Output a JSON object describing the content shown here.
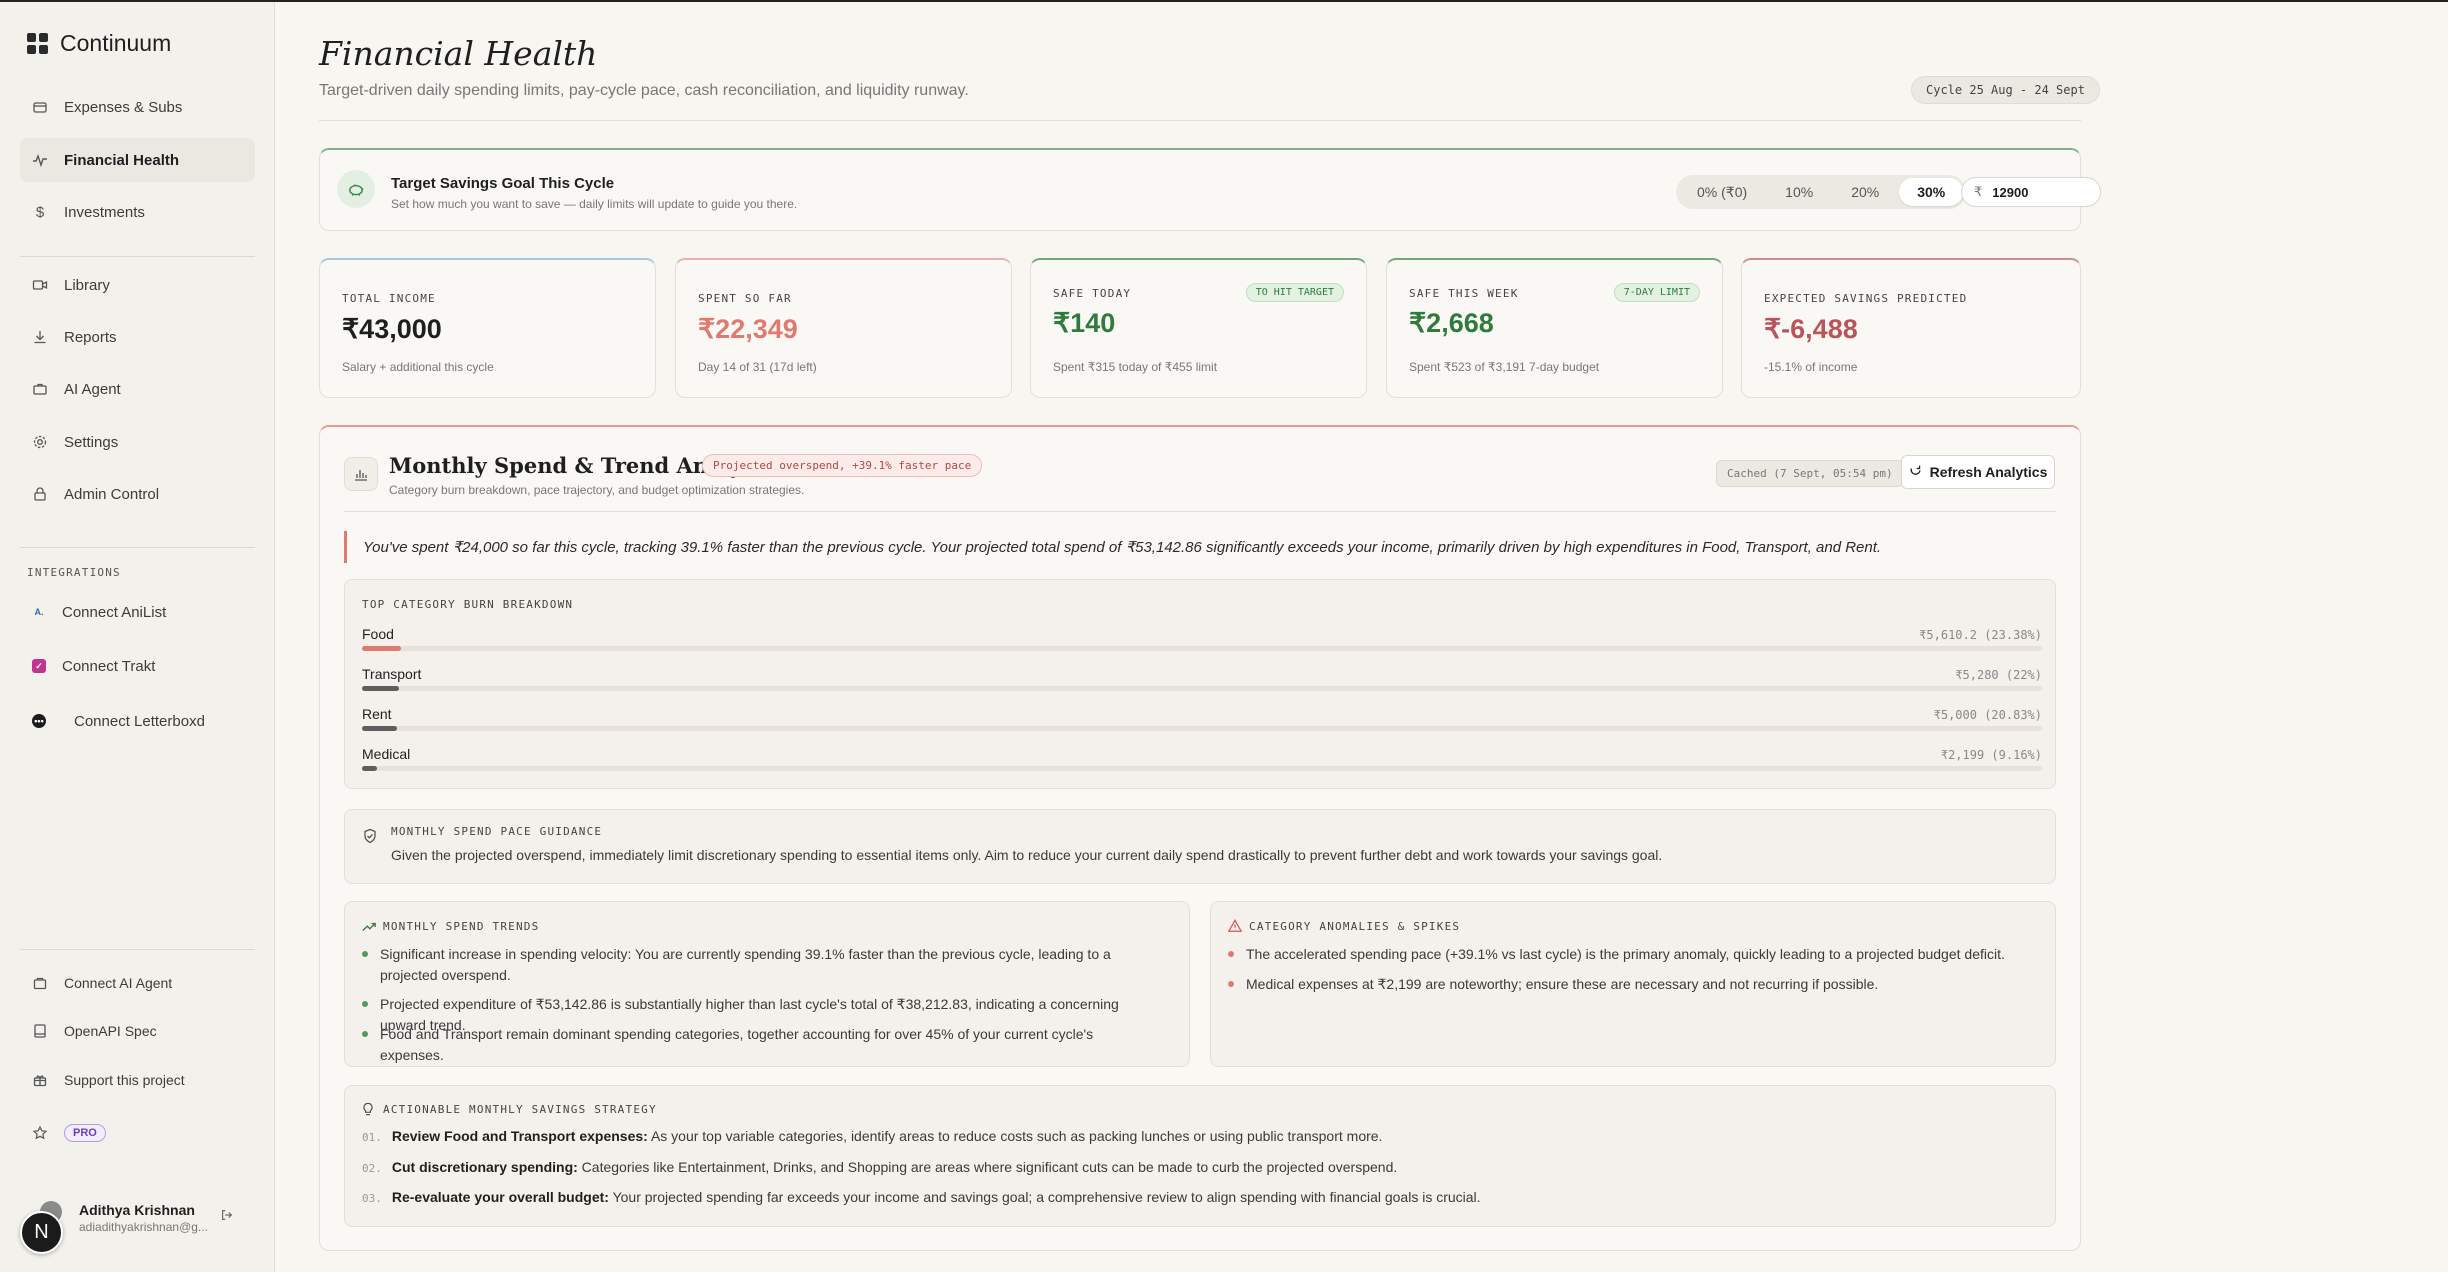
{
  "app": {
    "name": "Continuum"
  },
  "sidebar": {
    "primary": [
      {
        "label": "Expenses & Subs",
        "icon": "wallet-icon"
      },
      {
        "label": "Financial Health",
        "icon": "activity-icon",
        "active": true
      },
      {
        "label": "Investments",
        "icon": "dollar-icon"
      }
    ],
    "secondary": [
      {
        "label": "Library",
        "icon": "video-icon"
      },
      {
        "label": "Reports",
        "icon": "download-icon"
      },
      {
        "label": "AI Agent",
        "icon": "briefcase-icon"
      },
      {
        "label": "Settings",
        "icon": "gear-icon"
      },
      {
        "label": "Admin Control",
        "icon": "lock-icon"
      }
    ],
    "integrations_label": "INTEGRATIONS",
    "integrations": [
      {
        "label": "Connect AniList",
        "icon": "anilist-icon",
        "color": "#2b6cb0"
      },
      {
        "label": "Connect Trakt",
        "icon": "trakt-icon",
        "color": "#c2348f"
      },
      {
        "label": "Connect Letterboxd",
        "icon": "letterboxd-icon",
        "color": "#1b1b1b"
      }
    ],
    "footer": [
      {
        "label": "Connect AI Agent",
        "icon": "bag-icon"
      },
      {
        "label": "OpenAPI Spec",
        "icon": "book-icon"
      },
      {
        "label": "Support this project",
        "icon": "gift-icon"
      }
    ],
    "pro_label": "PRO",
    "user": {
      "name": "Adithya Krishnan",
      "email": "adiadithyakrishnan@g...",
      "avatar_letter": "N"
    }
  },
  "header": {
    "title": "Financial Health",
    "subtitle": "Target-driven daily spending limits, pay-cycle pace, cash reconciliation, and liquidity runway.",
    "cycle": "Cycle 25 Aug - 24 Sept"
  },
  "goal": {
    "title": "Target Savings Goal This Cycle",
    "subtitle": "Set how much you want to save — daily limits will update to guide you there.",
    "options": [
      "0% (₹0)",
      "10%",
      "20%",
      "30%"
    ],
    "selected": "30%",
    "currency": "₹",
    "amount": "12900"
  },
  "stats": [
    {
      "label": "TOTAL INCOME",
      "value": "₹43,000",
      "foot": "Salary + additional this cycle",
      "badge": "",
      "color": "#1f1f1f",
      "accent": "#a9c6e3"
    },
    {
      "label": "SPENT SO FAR",
      "value": "₹22,349",
      "foot": "Day 14 of 31 (17d left)",
      "badge": "",
      "color": "#e07a6f",
      "accent": "#ebb1aa"
    },
    {
      "label": "SAFE TODAY",
      "value": "₹140",
      "foot": "Spent ₹315 today of ₹455 limit",
      "badge": "TO HIT TARGET",
      "color": "#2f7a3d",
      "accent": "#6fa877"
    },
    {
      "label": "SAFE THIS WEEK",
      "value": "₹2,668",
      "foot": "Spent ₹523 of ₹3,191 7-day budget",
      "badge": "7-DAY LIMIT",
      "color": "#2f7a3d",
      "accent": "#6fa877"
    },
    {
      "label": "EXPECTED SAVINGS PREDICTED",
      "value": "₹-6,488",
      "foot": "-15.1% of income",
      "badge": "",
      "color": "#b9545a",
      "accent": "#cf8a8e"
    }
  ],
  "analytics": {
    "title": "Monthly Spend & Trend Analytics",
    "badge": "Projected overspend, +39.1% faster pace",
    "subtitle": "Category burn breakdown, pace trajectory, and budget optimization strategies.",
    "cached": "Cached (7 Sept, 05:54 pm)",
    "refresh_label": "Refresh Analytics",
    "summary": "You've spent ₹24,000 so far this cycle, tracking 39.1% faster than the previous cycle. Your projected total spend of ₹53,142.86 significantly exceeds your income, primarily driven by high expenditures in Food, Transport, and Rent.",
    "burn_label": "TOP CATEGORY BURN BREAKDOWN",
    "burn": [
      {
        "name": "Food",
        "amount": "₹5,610.2 (23.38%)",
        "pct": 23.38,
        "color": "#e07a6f"
      },
      {
        "name": "Transport",
        "amount": "₹5,280 (22%)",
        "pct": 22,
        "color": "#5e5e5e"
      },
      {
        "name": "Rent",
        "amount": "₹5,000 (20.83%)",
        "pct": 20.83,
        "color": "#5e5e5e"
      },
      {
        "name": "Medical",
        "amount": "₹2,199 (9.16%)",
        "pct": 9.16,
        "color": "#5e5e5e"
      }
    ],
    "pace_label": "MONTHLY SPEND PACE GUIDANCE",
    "pace_text": "Given the projected overspend, immediately limit discretionary spending to essential items only. Aim to reduce your current daily spend drastically to prevent further debt and work towards your savings goal.",
    "trends_label": "MONTHLY SPEND TRENDS",
    "trends": [
      "Significant increase in spending velocity: You are currently spending 39.1% faster than the previous cycle, leading to a projected overspend.",
      "Projected expenditure of ₹53,142.86 is substantially higher than last cycle's total of ₹38,212.83, indicating a concerning upward trend.",
      "Food and Transport remain dominant spending categories, together accounting for over 45% of your current cycle's expenses."
    ],
    "anomalies_label": "CATEGORY ANOMALIES & SPIKES",
    "anomalies": [
      "The accelerated spending pace (+39.1% vs last cycle) is the primary anomaly, quickly leading to a projected budget deficit.",
      "Medical expenses at ₹2,199 are noteworthy; ensure these are necessary and not recurring if possible."
    ],
    "strategy_label": "ACTIONABLE MONTHLY SAVINGS STRATEGY",
    "strategy": [
      {
        "num": "01.",
        "title": "Review Food and Transport expenses:",
        "text": " As your top variable categories, identify areas to reduce costs such as packing lunches or using public transport more."
      },
      {
        "num": "02.",
        "title": "Cut discretionary spending:",
        "text": " Categories like Entertainment, Drinks, and Shopping are areas where significant cuts can be made to curb the projected overspend."
      },
      {
        "num": "03.",
        "title": "Re-evaluate your overall budget:",
        "text": " Your projected spending far exceeds your income and savings goal; a comprehensive review to align spending with financial goals is crucial."
      }
    ]
  }
}
